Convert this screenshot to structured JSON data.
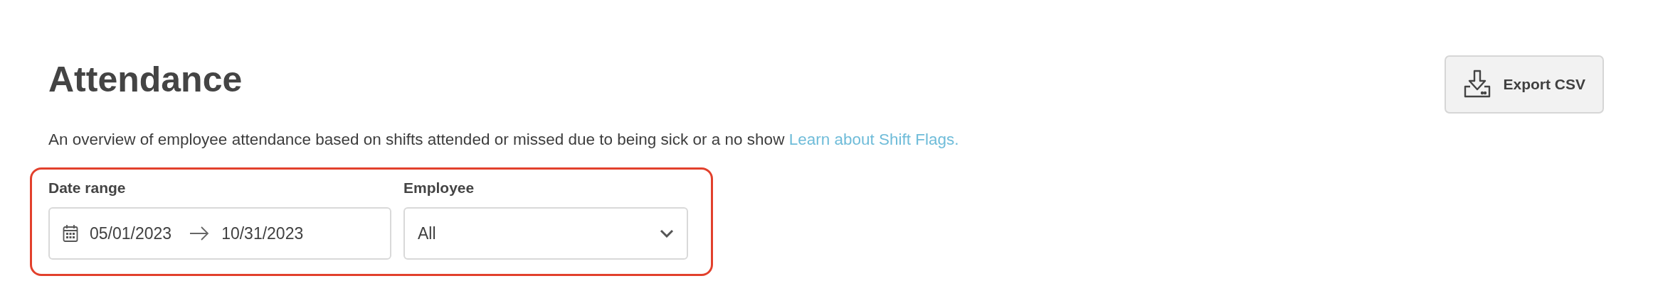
{
  "header": {
    "title": "Attendance",
    "export_button": "Export CSV"
  },
  "description": {
    "text": "An overview of employee attendance based on shifts attended or missed due to being sick or a no show",
    "link": "Learn about Shift Flags."
  },
  "filters": {
    "highlighted": true,
    "date_range": {
      "label": "Date range",
      "start": "05/01/2023",
      "end": "10/31/2023"
    },
    "employee": {
      "label": "Employee",
      "value": "All"
    }
  }
}
